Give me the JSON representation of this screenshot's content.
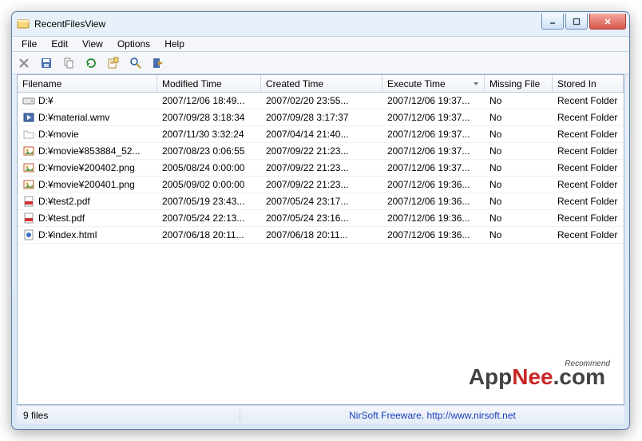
{
  "app": {
    "title": "RecentFilesView"
  },
  "menu": {
    "items": [
      "File",
      "Edit",
      "View",
      "Options",
      "Help"
    ]
  },
  "toolbar": {
    "buttons": [
      {
        "name": "delete-icon"
      },
      {
        "name": "save-icon"
      },
      {
        "name": "copy-icon"
      },
      {
        "name": "refresh-icon"
      },
      {
        "name": "properties-icon"
      },
      {
        "name": "find-icon"
      },
      {
        "name": "exit-icon"
      }
    ]
  },
  "columns": [
    "Filename",
    "Modified Time",
    "Created Time",
    "Execute Time",
    "Missing File",
    "Stored In"
  ],
  "sort": {
    "col": 3,
    "dir": "desc"
  },
  "rows": [
    {
      "icon": "drive",
      "filename": "D:¥",
      "modified": "2007/12/06 18:49...",
      "created": "2007/02/20 23:55...",
      "execute": "2007/12/06 19:37...",
      "missing": "No",
      "stored": "Recent Folder"
    },
    {
      "icon": "video",
      "filename": "D:¥material.wmv",
      "modified": "2007/09/28 3:18:34",
      "created": "2007/09/28 3:17:37",
      "execute": "2007/12/06 19:37...",
      "missing": "No",
      "stored": "Recent Folder"
    },
    {
      "icon": "folder",
      "filename": "D:¥movie",
      "modified": "2007/11/30 3:32:24",
      "created": "2007/04/14 21:40...",
      "execute": "2007/12/06 19:37...",
      "missing": "No",
      "stored": "Recent Folder"
    },
    {
      "icon": "image",
      "filename": "D:¥movie¥853884_52...",
      "modified": "2007/08/23 0:06:55",
      "created": "2007/09/22 21:23...",
      "execute": "2007/12/06 19:37...",
      "missing": "No",
      "stored": "Recent Folder"
    },
    {
      "icon": "image",
      "filename": "D:¥movie¥200402.png",
      "modified": "2005/08/24 0:00:00",
      "created": "2007/09/22 21:23...",
      "execute": "2007/12/06 19:37...",
      "missing": "No",
      "stored": "Recent Folder"
    },
    {
      "icon": "image",
      "filename": "D:¥movie¥200401.png",
      "modified": "2005/09/02 0:00:00",
      "created": "2007/09/22 21:23...",
      "execute": "2007/12/06 19:36...",
      "missing": "No",
      "stored": "Recent Folder"
    },
    {
      "icon": "pdf",
      "filename": "D:¥test2.pdf",
      "modified": "2007/05/19 23:43...",
      "created": "2007/05/24 23:17...",
      "execute": "2007/12/06 19:36...",
      "missing": "No",
      "stored": "Recent Folder"
    },
    {
      "icon": "pdf",
      "filename": "D:¥test.pdf",
      "modified": "2007/05/24 22:13...",
      "created": "2007/05/24 23:16...",
      "execute": "2007/12/06 19:36...",
      "missing": "No",
      "stored": "Recent Folder"
    },
    {
      "icon": "html",
      "filename": "D:¥index.html",
      "modified": "2007/06/18 20:11...",
      "created": "2007/06/18 20:11...",
      "execute": "2007/12/06 19:36...",
      "missing": "No",
      "stored": "Recent Folder"
    }
  ],
  "status": {
    "left": "9 files",
    "center": "NirSoft Freeware.  http://www.nirsoft.net"
  },
  "watermark": {
    "pre": "App",
    "mid": "Nee",
    "suf": ".com",
    "tag": "Recommend"
  }
}
